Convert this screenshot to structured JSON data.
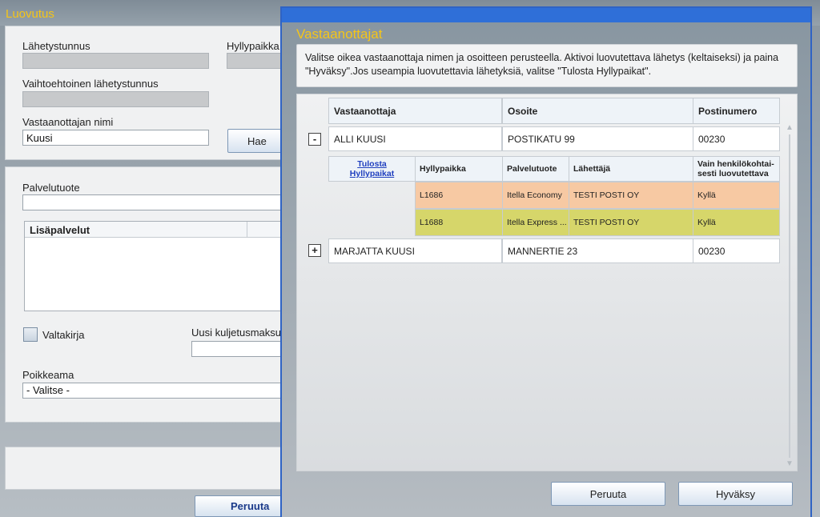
{
  "background": {
    "title": "Luovutus",
    "fields": {
      "lahetystunnus_label": "Lähetystunnus",
      "hyllypaikka_label": "Hyllypaikka",
      "vaihtoehtoinen_label": "Vaihtoehtoinen lähetystunnus",
      "vastaanottajan_nimi_label": "Vastaanottajan nimi",
      "vastaanottajan_nimi_value": "Kuusi",
      "search_button": "Hae",
      "palvelutuote_label": "Palvelutuote",
      "lisapalvelut_header": "Lisäpalvelut",
      "valtakirja_label": "Valtakirja",
      "uusi_kuljetusmaksu_label": "Uusi kuljetusmaksu",
      "poikkeama_label": "Poikkeama",
      "poikkeama_value": "- Valitse -",
      "cancel_button": "Peruuta"
    }
  },
  "dialog": {
    "title": "Vastaanottajat",
    "instructions": "Valitse oikea vastaanottaja nimen ja osoitteen perusteella. Aktivoi luovutettava lähetys (keltaiseksi) ja paina \"Hyväksy\".Jos useampia luovutettavia lähetyksiä, valitse \"Tulosta Hyllypaikat\".",
    "columns": {
      "recipient": "Vastaanottaja",
      "address": "Osoite",
      "postal": "Postinumero"
    },
    "recipients": [
      {
        "toggle": "-",
        "name": "ALLI KUUSI",
        "address": "POSTIKATU 99",
        "postal": "00230",
        "expanded": true,
        "sub_columns": {
          "print_link": "Tulosta Hyllypaikat",
          "shelf": "Hyllypaikka",
          "service": "Palvelutuote",
          "sender": "Lähettäjä",
          "personal": "Vain henkilökohtai-sesti luovutettava"
        },
        "shipments": [
          {
            "shelf": "L1686",
            "service": "Itella Economy",
            "sender": "TESTI  POSTI OY",
            "personal": "Kyllä",
            "color": "#f7c9a3"
          },
          {
            "shelf": "L1688",
            "service": "Itella Express ...",
            "sender": "TESTI  POSTI OY",
            "personal": "Kyllä",
            "color": "#d6d66a"
          }
        ]
      },
      {
        "toggle": "+",
        "name": "MARJATTA KUUSI",
        "address": "MANNERTIE 23",
        "postal": "00230",
        "expanded": false
      }
    ],
    "cancel_button": "Peruuta",
    "accept_button": "Hyväksy"
  }
}
